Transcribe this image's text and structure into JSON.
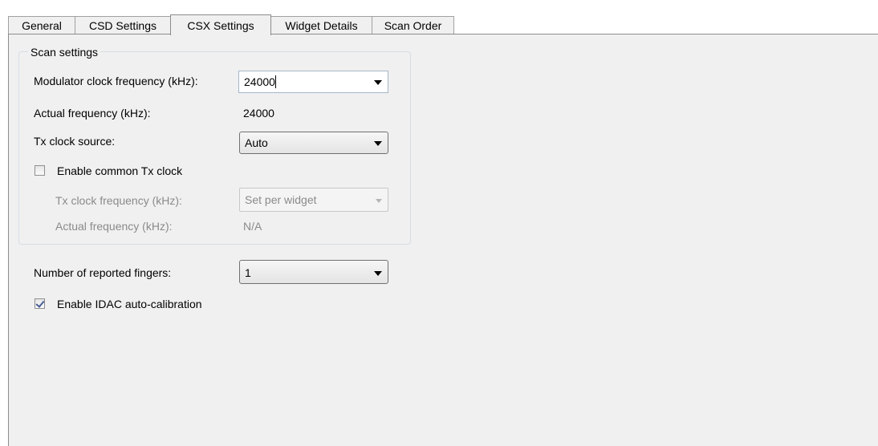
{
  "tabs": [
    {
      "label": "General"
    },
    {
      "label": "CSD Settings"
    },
    {
      "label": "CSX Settings"
    },
    {
      "label": "Widget Details"
    },
    {
      "label": "Scan Order"
    }
  ],
  "active_tab": "CSX Settings",
  "scan_settings": {
    "title": "Scan settings",
    "mod_clk_label": "Modulator clock frequency (kHz):",
    "mod_clk_value": "24000",
    "actual_freq_label": "Actual frequency (kHz):",
    "actual_freq_value": "24000",
    "tx_src_label": "Tx clock source:",
    "tx_src_value": "Auto",
    "common_tx_label": "Enable common Tx clock",
    "common_tx_checked": false,
    "tx_freq_label": "Tx clock frequency (kHz):",
    "tx_freq_value": "Set per widget",
    "tx_actual_label": "Actual frequency (kHz):",
    "tx_actual_value": "N/A"
  },
  "fingers_label": "Number of reported fingers:",
  "fingers_value": "1",
  "idac_label": "Enable IDAC auto-calibration",
  "idac_checked": true
}
